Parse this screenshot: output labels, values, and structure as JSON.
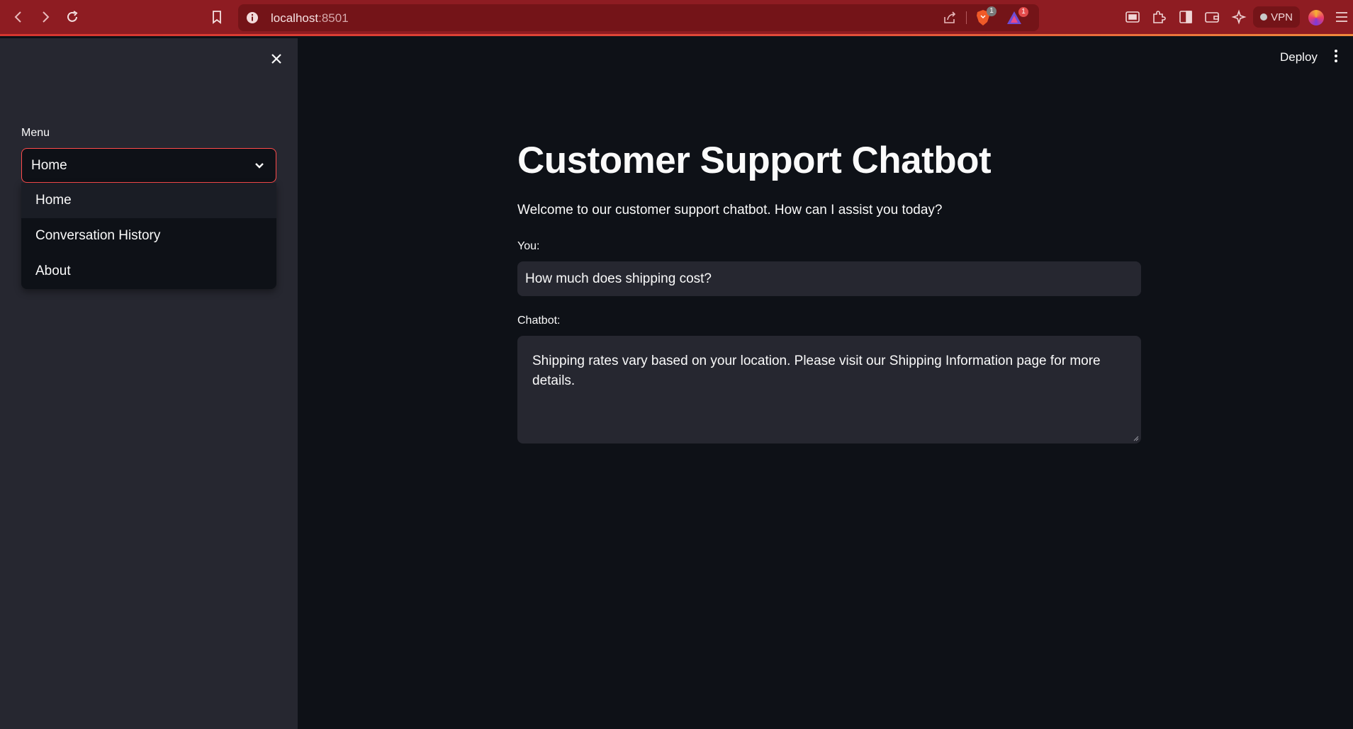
{
  "browser": {
    "url_host": "localhost",
    "url_port": ":8501",
    "brave_shields_count": "1",
    "rewards_count": "1",
    "vpn_label": "VPN"
  },
  "sidebar": {
    "menu_label": "Menu",
    "selected": "Home",
    "options": [
      "Home",
      "Conversation History",
      "About"
    ]
  },
  "header": {
    "deploy_label": "Deploy"
  },
  "main": {
    "title": "Customer Support Chatbot",
    "welcome": "Welcome to our customer support chatbot. How can I assist you today?",
    "you_label": "You:",
    "you_value": "How much does shipping cost?",
    "chatbot_label": "Chatbot:",
    "chatbot_value": "Shipping rates vary based on your location. Please visit our Shipping Information page for more details."
  }
}
